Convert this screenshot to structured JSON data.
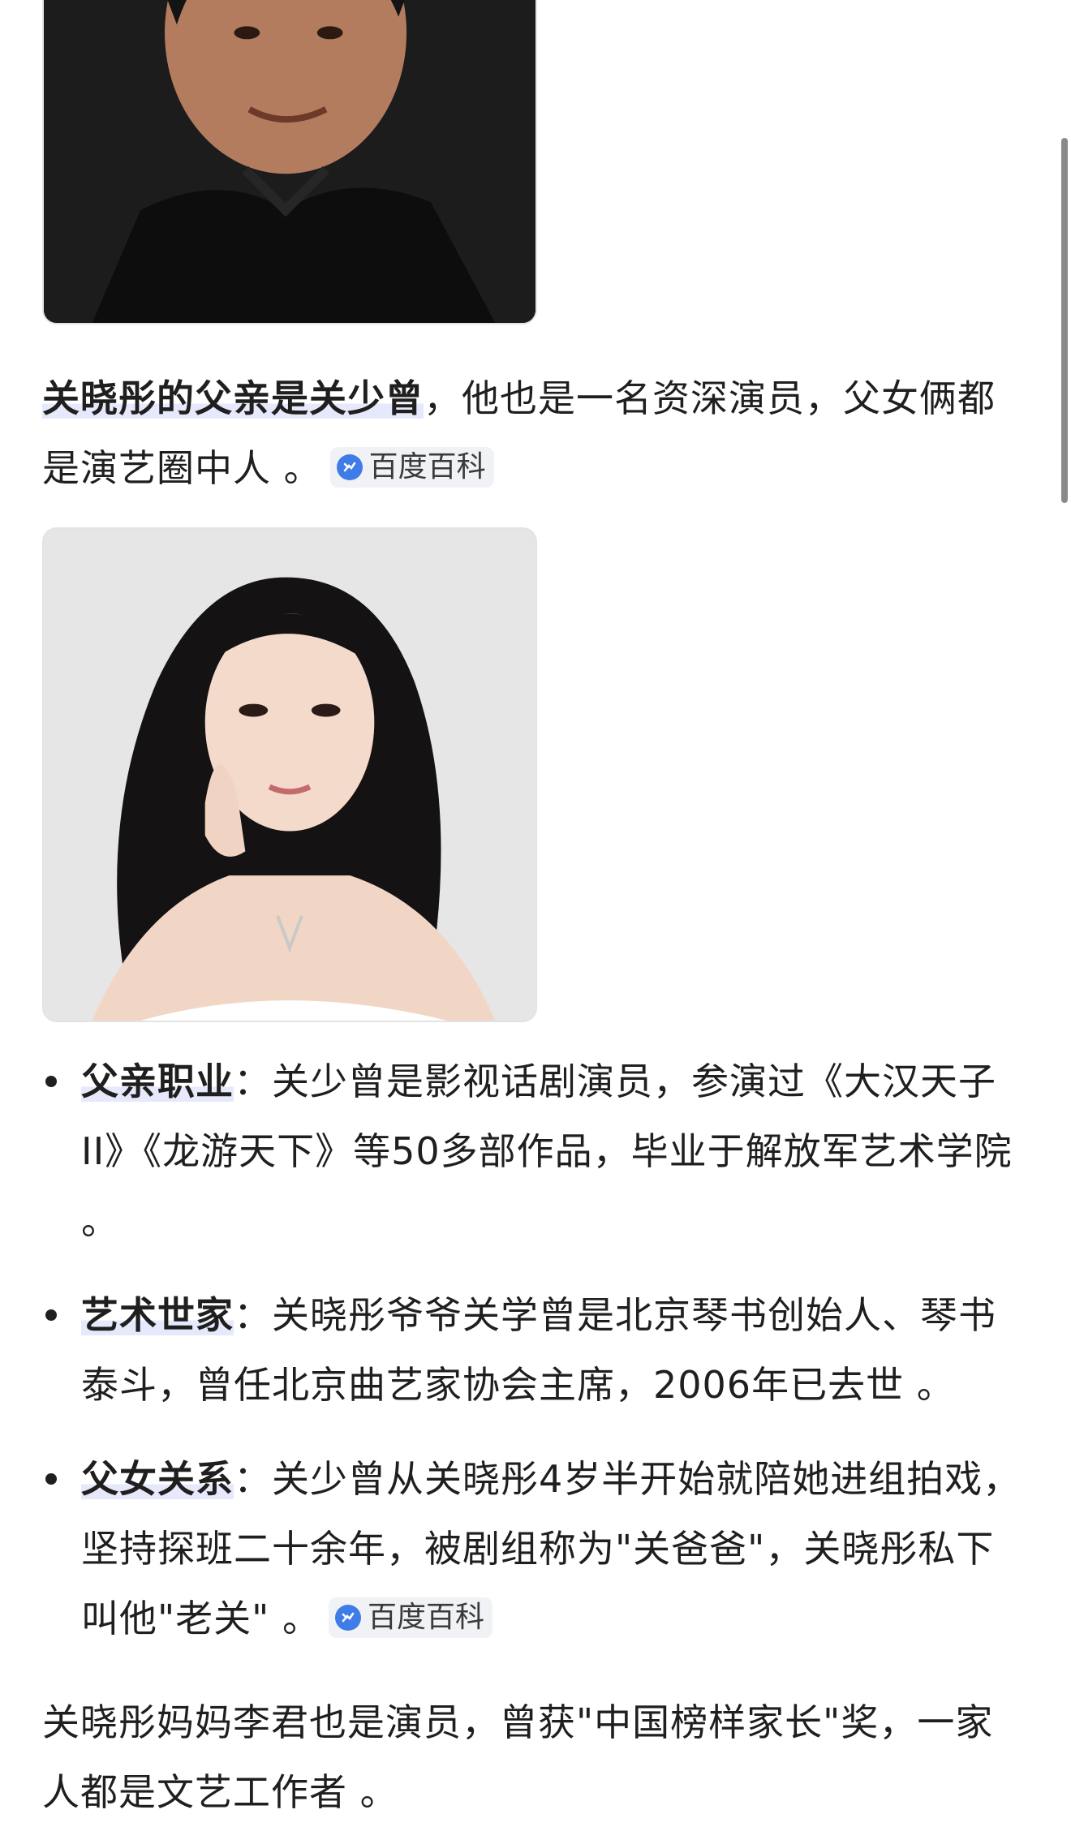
{
  "images": {
    "father_photo": {
      "name": "father-photo"
    },
    "daughter_photo": {
      "name": "daughter-photo"
    }
  },
  "intro": {
    "highlight": "关晓彤的父亲是关少曾",
    "text": "，他也是一名资深演员，父女俩都是演艺圈中人 。",
    "cite": "百度百科"
  },
  "bullets": [
    {
      "label": "父亲职业",
      "text": "：关少曾是影视话剧演员，参演过《大汉天子II》《龙游天下》等50多部作品，毕业于解放军艺术学院 。",
      "cite": ""
    },
    {
      "label": "艺术世家",
      "text": "：关晓彤爷爷关学曾是北京琴书创始人、琴书泰斗，曾任北京曲艺家协会主席，2006年已去世 。",
      "cite": ""
    },
    {
      "label": "父女关系",
      "text": "：关少曾从关晓彤4岁半开始就陪她进组拍戏，坚持探班二十余年，被剧组称为\"关爸爸\"，关晓彤私下叫他\"老关\" 。",
      "cite": "百度百科"
    }
  ],
  "outro": {
    "text": "关晓彤妈妈李君也是演员，曾获\"中国榜样家长\"奖，一家人都是文艺工作者 。"
  },
  "colors": {
    "highlight": "#e6e9fb",
    "cite_icon": "#3f7ce8",
    "text": "#1f1f1f"
  }
}
